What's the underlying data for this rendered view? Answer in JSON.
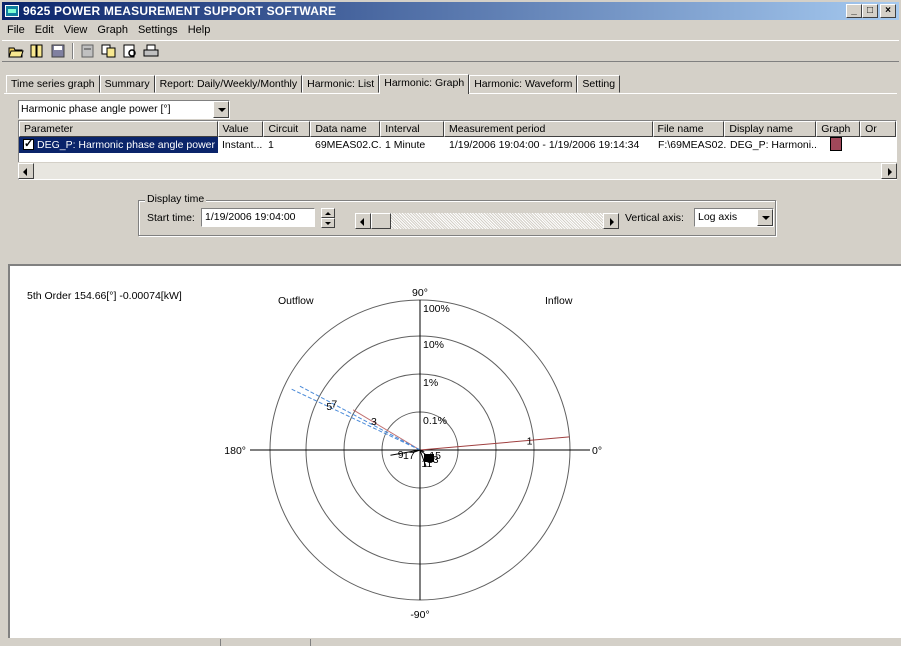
{
  "title": "9625 POWER MEASUREMENT SUPPORT SOFTWARE",
  "menu": [
    "File",
    "Edit",
    "View",
    "Graph",
    "Settings",
    "Help"
  ],
  "toolbar_icons": [
    "open-folder-icon",
    "book-icon",
    "save-icon",
    "export-icon",
    "copy-icon",
    "print-preview-icon",
    "print-icon"
  ],
  "tabs": [
    "Time series graph",
    "Summary",
    "Report: Daily/Weekly/Monthly",
    "Harmonic: List",
    "Harmonic: Graph",
    "Harmonic: Waveform",
    "Setting"
  ],
  "active_tab": "Harmonic: Graph",
  "selector": {
    "value": "Harmonic phase angle power [°]"
  },
  "grid": {
    "headers": [
      "Parameter",
      "Value",
      "Circuit",
      "Data name",
      "Interval",
      "Measurement period",
      "File name",
      "Display name",
      "Graph",
      "Or"
    ],
    "row": {
      "parameter": "DEG_P: Harmonic phase angle power",
      "value": "Instant...",
      "circuit": "1",
      "data_name": "69MEAS02.C...",
      "interval": "1 Minute",
      "period": "1/19/2006 19:04:00 - 1/19/2006 19:14:34",
      "file_name": "F:\\69MEAS02.",
      "display_name": "DEG_P: Harmoni...",
      "graph_color": "#a0485a"
    }
  },
  "display_time": {
    "group_label": "Display time",
    "start_label": "Start time:",
    "start_value": "1/19/2006  19:04:00",
    "vaxis_label": "Vertical axis:",
    "vaxis_value": "Log axis"
  },
  "graph": {
    "info": "5th Order 154.66[°] -0.00074[kW]",
    "outflow": "Outflow",
    "inflow": "Inflow",
    "angle_labels": {
      "top": "90°",
      "bottom": "-90°",
      "left": "180°",
      "right": "0°"
    },
    "ring_labels": [
      "100%",
      "10%",
      "1%",
      "0.1%"
    ],
    "harmonics": [
      {
        "order": "1",
        "angle": 5,
        "mag": 1.0,
        "color": "#a04040"
      },
      {
        "order": "3",
        "angle": 149,
        "mag": 0.52,
        "color": "#c07070"
      },
      {
        "order": "5",
        "angle": 154.66,
        "mag": 0.95,
        "color": "#4a8ad8"
      },
      {
        "order": "7",
        "angle": 152,
        "mag": 0.92,
        "color": "#4a8ad8"
      },
      {
        "order": "9",
        "angle": 190,
        "mag": 0.2,
        "color": "#000000"
      },
      {
        "order": "11",
        "angle": -70,
        "mag": 0.12,
        "color": "#000000"
      },
      {
        "order": "13",
        "angle": -40,
        "mag": 0.06,
        "color": "#000000"
      },
      {
        "order": "15",
        "angle": -20,
        "mag": 0.03,
        "color": "#000000"
      },
      {
        "order": "17",
        "angle": 200,
        "mag": 0.05,
        "color": "#000000"
      }
    ]
  }
}
